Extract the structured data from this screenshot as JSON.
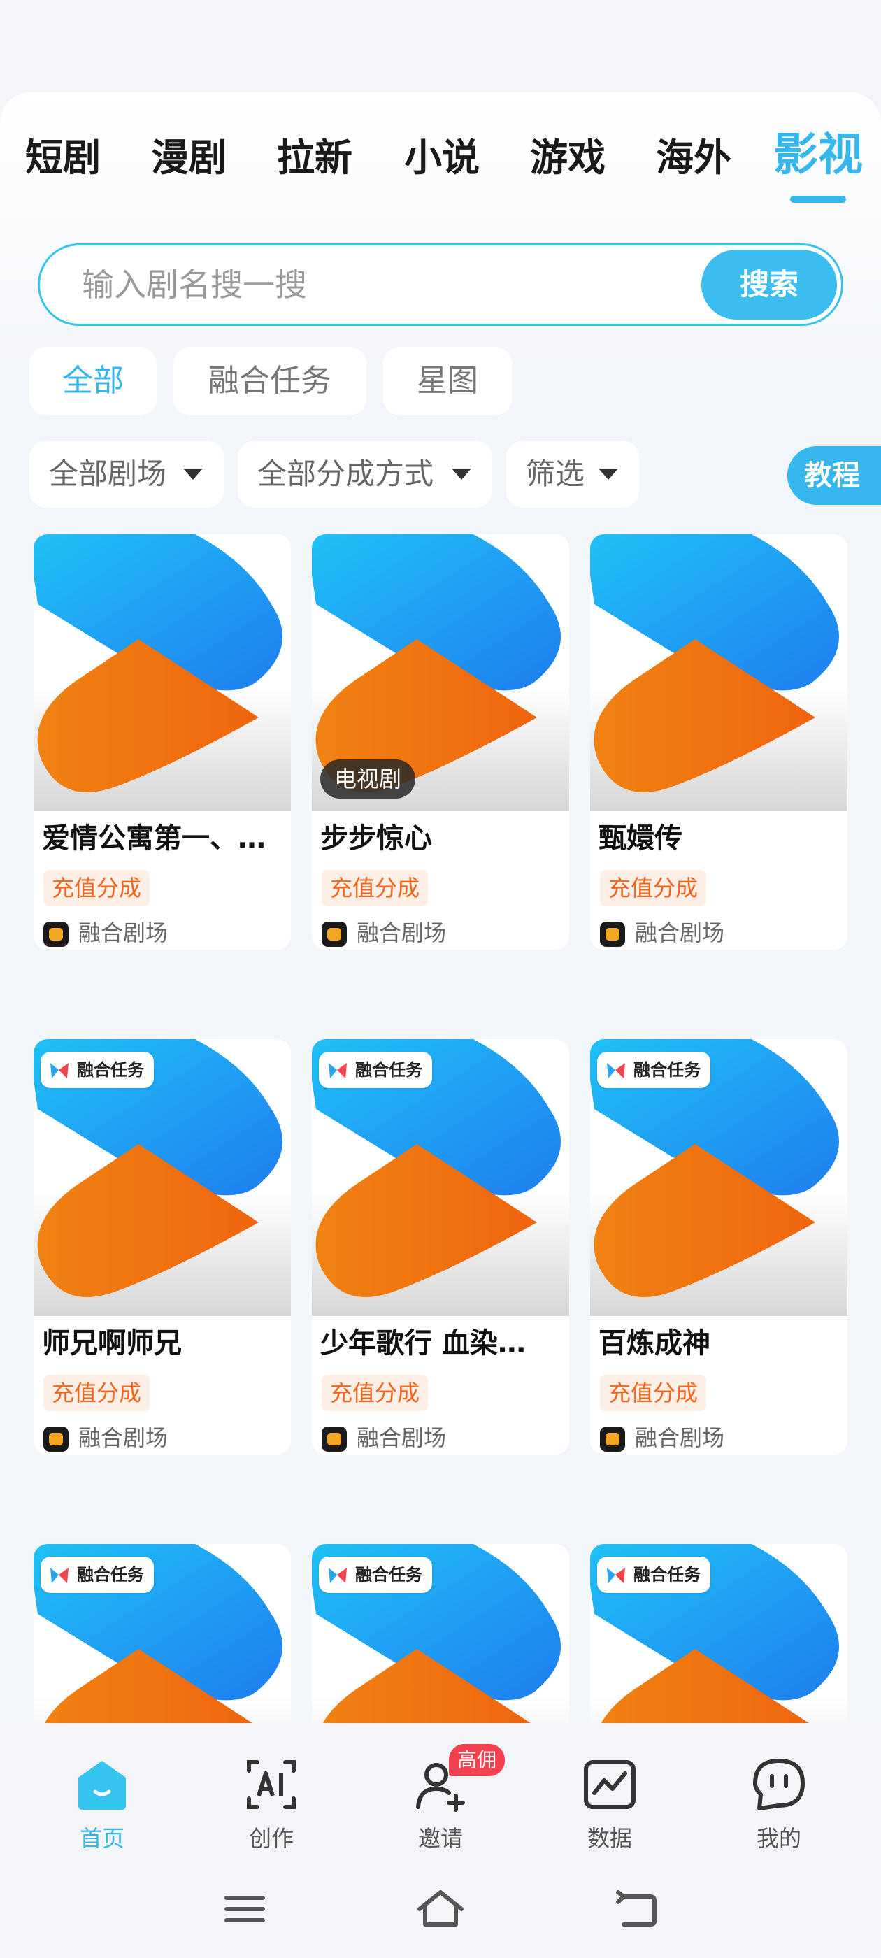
{
  "category_tabs": [
    {
      "label": "短剧",
      "active": false
    },
    {
      "label": "漫剧",
      "active": false
    },
    {
      "label": "拉新",
      "active": false
    },
    {
      "label": "小说",
      "active": false
    },
    {
      "label": "游戏",
      "active": false
    },
    {
      "label": "海外",
      "active": false
    },
    {
      "label": "影视",
      "active": true
    }
  ],
  "search": {
    "placeholder": "输入剧名搜一搜",
    "button_label": "搜索"
  },
  "filter_tabs": [
    {
      "label": "全部",
      "active": true
    },
    {
      "label": "融合任务",
      "active": false
    },
    {
      "label": "星图",
      "active": false
    }
  ],
  "dropdowns": [
    {
      "label": "全部剧场"
    },
    {
      "label": "全部分成方式"
    },
    {
      "label": "筛选"
    }
  ],
  "tutorial_label": "教程",
  "cards": [
    {
      "title": "爱情公寓第一、…",
      "tag": "充值分成",
      "source": "融合剧场",
      "badge": ""
    },
    {
      "title": "步步惊心",
      "tag": "充值分成",
      "source": "融合剧场",
      "badge": "电视剧"
    },
    {
      "title": "甄嬛传",
      "tag": "充值分成",
      "source": "融合剧场",
      "badge": ""
    },
    {
      "title": "师兄啊师兄",
      "tag": "充值分成",
      "source": "融合剧场",
      "badge": "融合任务"
    },
    {
      "title": "少年歌行 血染…",
      "tag": "充值分成",
      "source": "融合剧场",
      "badge": "融合任务"
    },
    {
      "title": "百炼成神",
      "tag": "充值分成",
      "source": "融合剧场",
      "badge": "融合任务"
    },
    {
      "title": "",
      "tag": "",
      "source": "",
      "badge": "融合任务"
    },
    {
      "title": "",
      "tag": "",
      "source": "",
      "badge": "融合任务"
    },
    {
      "title": "",
      "tag": "",
      "source": "",
      "badge": "融合任务"
    }
  ],
  "bottom_nav": [
    {
      "label": "首页",
      "icon": "home-icon",
      "active": true
    },
    {
      "label": "创作",
      "icon": "ai-create-icon",
      "active": false
    },
    {
      "label": "邀请",
      "icon": "invite-user-icon",
      "active": false,
      "badge": "高佣"
    },
    {
      "label": "数据",
      "icon": "chart-icon",
      "active": false
    },
    {
      "label": "我的",
      "icon": "chat-face-icon",
      "active": false
    }
  ],
  "colors": {
    "accent": "#35b6ec",
    "tag_text": "#f0651d",
    "tag_bg": "#fdeee6",
    "badge_red": "#f44150"
  }
}
